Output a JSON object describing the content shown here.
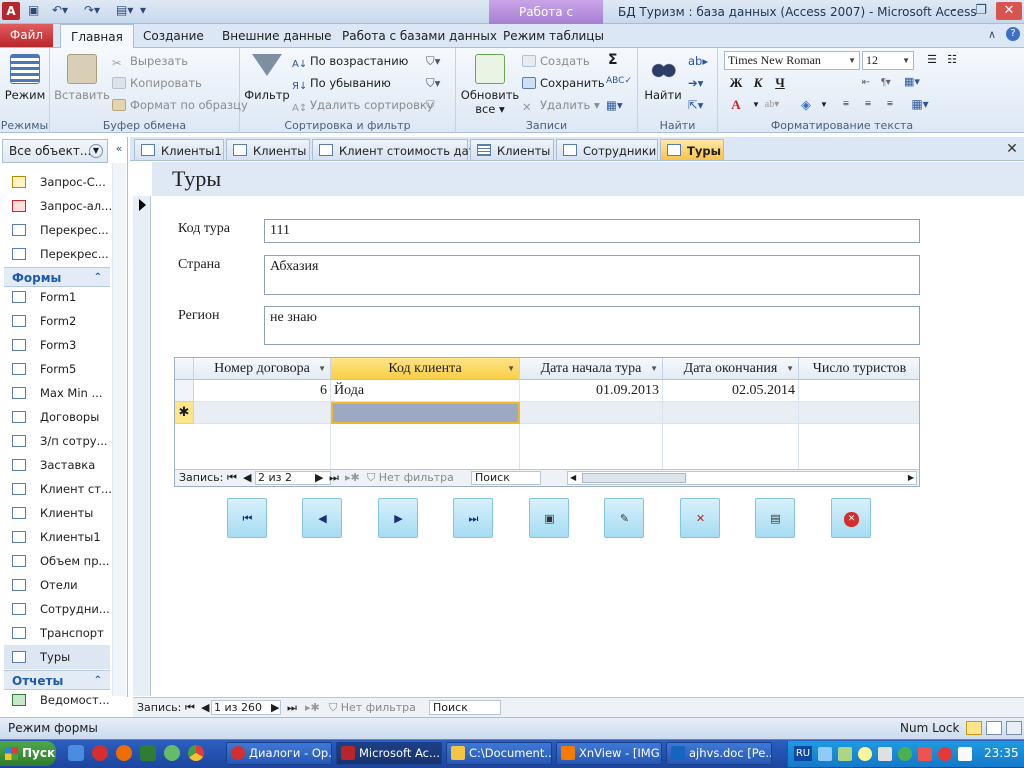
{
  "window": {
    "title": "БД Туризм : база данных (Access 2007)  -  Microsoft Access",
    "context_tab_group": "Работа с формами"
  },
  "ribbon": {
    "tabs": [
      "Файл",
      "Главная",
      "Создание",
      "Внешние данные",
      "Работа с базами данных",
      "Режим таблицы"
    ],
    "groups": {
      "modes": {
        "label": "Режимы",
        "view": "Режим"
      },
      "clipboard": {
        "label": "Буфер обмена",
        "paste": "Вставить",
        "cut": "Вырезать",
        "copy": "Копировать",
        "format_painter": "Формат по образцу"
      },
      "sort_filter": {
        "label": "Сортировка и фильтр",
        "filter": "Фильтр",
        "ascending": "По возрастанию",
        "descending": "По убыванию",
        "clear_sort": "Удалить сортировку"
      },
      "records": {
        "label": "Записи",
        "refresh": "Обновить",
        "refresh2": "все",
        "new": "Создать",
        "save": "Сохранить",
        "delete": "Удалить"
      },
      "find": {
        "label": "Найти",
        "find": "Найти"
      },
      "text_format": {
        "label": "Форматирование текста",
        "font": "Times New Roman",
        "size": "12",
        "bold": "Ж",
        "italic": "К",
        "underline": "Ч"
      }
    }
  },
  "nav_pane": {
    "header": "Все объект...",
    "query_items": [
      "Запрос-С...",
      "Запрос-ал...",
      "Перекрес...",
      "Перекрес..."
    ],
    "forms_header": "Формы",
    "form_items": [
      "Form1",
      "Form2",
      "Form3",
      "Form5",
      "Max Min ...",
      "Договоры",
      "З/п сотру...",
      "Заставка",
      "Клиент ст...",
      "Клиенты",
      "Клиенты1",
      "Объем пр...",
      "Отели",
      "Сотрудни...",
      "Транспорт",
      "Туры"
    ],
    "reports_header": "Отчеты",
    "report_items": [
      "Ведомост..."
    ]
  },
  "doc_tabs": [
    "Клиенты1",
    "Клиенты",
    "Клиент стоимость дата",
    "Клиенты",
    "Сотрудники",
    "Туры"
  ],
  "form": {
    "title": "Туры",
    "fields": [
      {
        "label": "Код тура",
        "value": "111"
      },
      {
        "label": "Страна",
        "value": "Абхазия"
      },
      {
        "label": "Регион",
        "value": "не знаю"
      }
    ],
    "subform": {
      "columns": [
        "Номер договора",
        "Код клиента",
        "Дата начала тура",
        "Дата окончания",
        "Число туристов"
      ],
      "rows": [
        [
          "6",
          "Йода",
          "01.09.2013",
          "02.05.2014",
          ""
        ]
      ],
      "new_row_marker": "✱",
      "nav": {
        "label": "Запись:",
        "position": "2 из 2",
        "filter": "Нет фильтра",
        "search": "Поиск"
      }
    },
    "buttons": [
      "first-record",
      "previous-record",
      "next-record",
      "last-record",
      "add-record",
      "edit-record",
      "delete-record",
      "open-form",
      "close-form"
    ]
  },
  "main_nav": {
    "label": "Запись:",
    "position": "1 из 260",
    "filter": "Нет фильтра",
    "search": "Поиск"
  },
  "status_bar": {
    "left": "Режим формы",
    "num_lock": "Num Lock"
  },
  "taskbar": {
    "start": "Пуск",
    "tasks": [
      "Диалоги - Ор...",
      "Microsoft Ac...",
      "C:\\Document...",
      "XnView - [IMG...",
      "ajhvs.doc [Pe..."
    ],
    "lang": "RU",
    "time": "23:35"
  },
  "colors": {
    "accent": "#f7c34a",
    "context_tab": "#a77fd2",
    "file_tab": "#c8333a",
    "command_button": "#a5dcf3",
    "taskbar": "#2452ad"
  }
}
